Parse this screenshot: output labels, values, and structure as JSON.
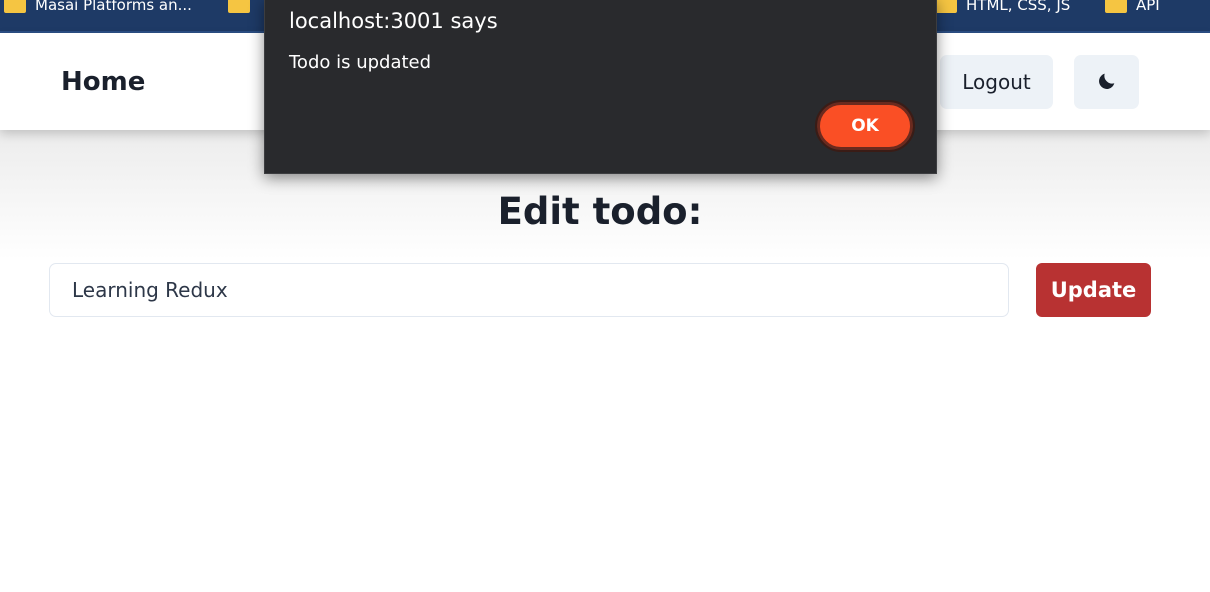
{
  "bookmarks": [
    {
      "label": "Masai Platforms an...",
      "icon": "folder-icon"
    },
    {
      "label": "HTML, CSS, JS",
      "icon": "folder-icon"
    },
    {
      "label": "API",
      "icon": "folder-icon"
    }
  ],
  "navbar": {
    "home_label": "Home",
    "logout_label": "Logout",
    "theme_icon": "moon-icon"
  },
  "main": {
    "title": "Edit todo:",
    "todo_value": "Learning Redux",
    "update_label": "Update"
  },
  "dialog": {
    "title": "localhost:3001 says",
    "message": "Todo is updated",
    "ok_label": "OK"
  },
  "colors": {
    "bookmarks_bar": "#1e3a66",
    "update_button": "#b83232",
    "dialog_bg": "#292a2d",
    "dialog_ok": "#fa4f25",
    "nav_button_bg": "#edf2f7"
  }
}
